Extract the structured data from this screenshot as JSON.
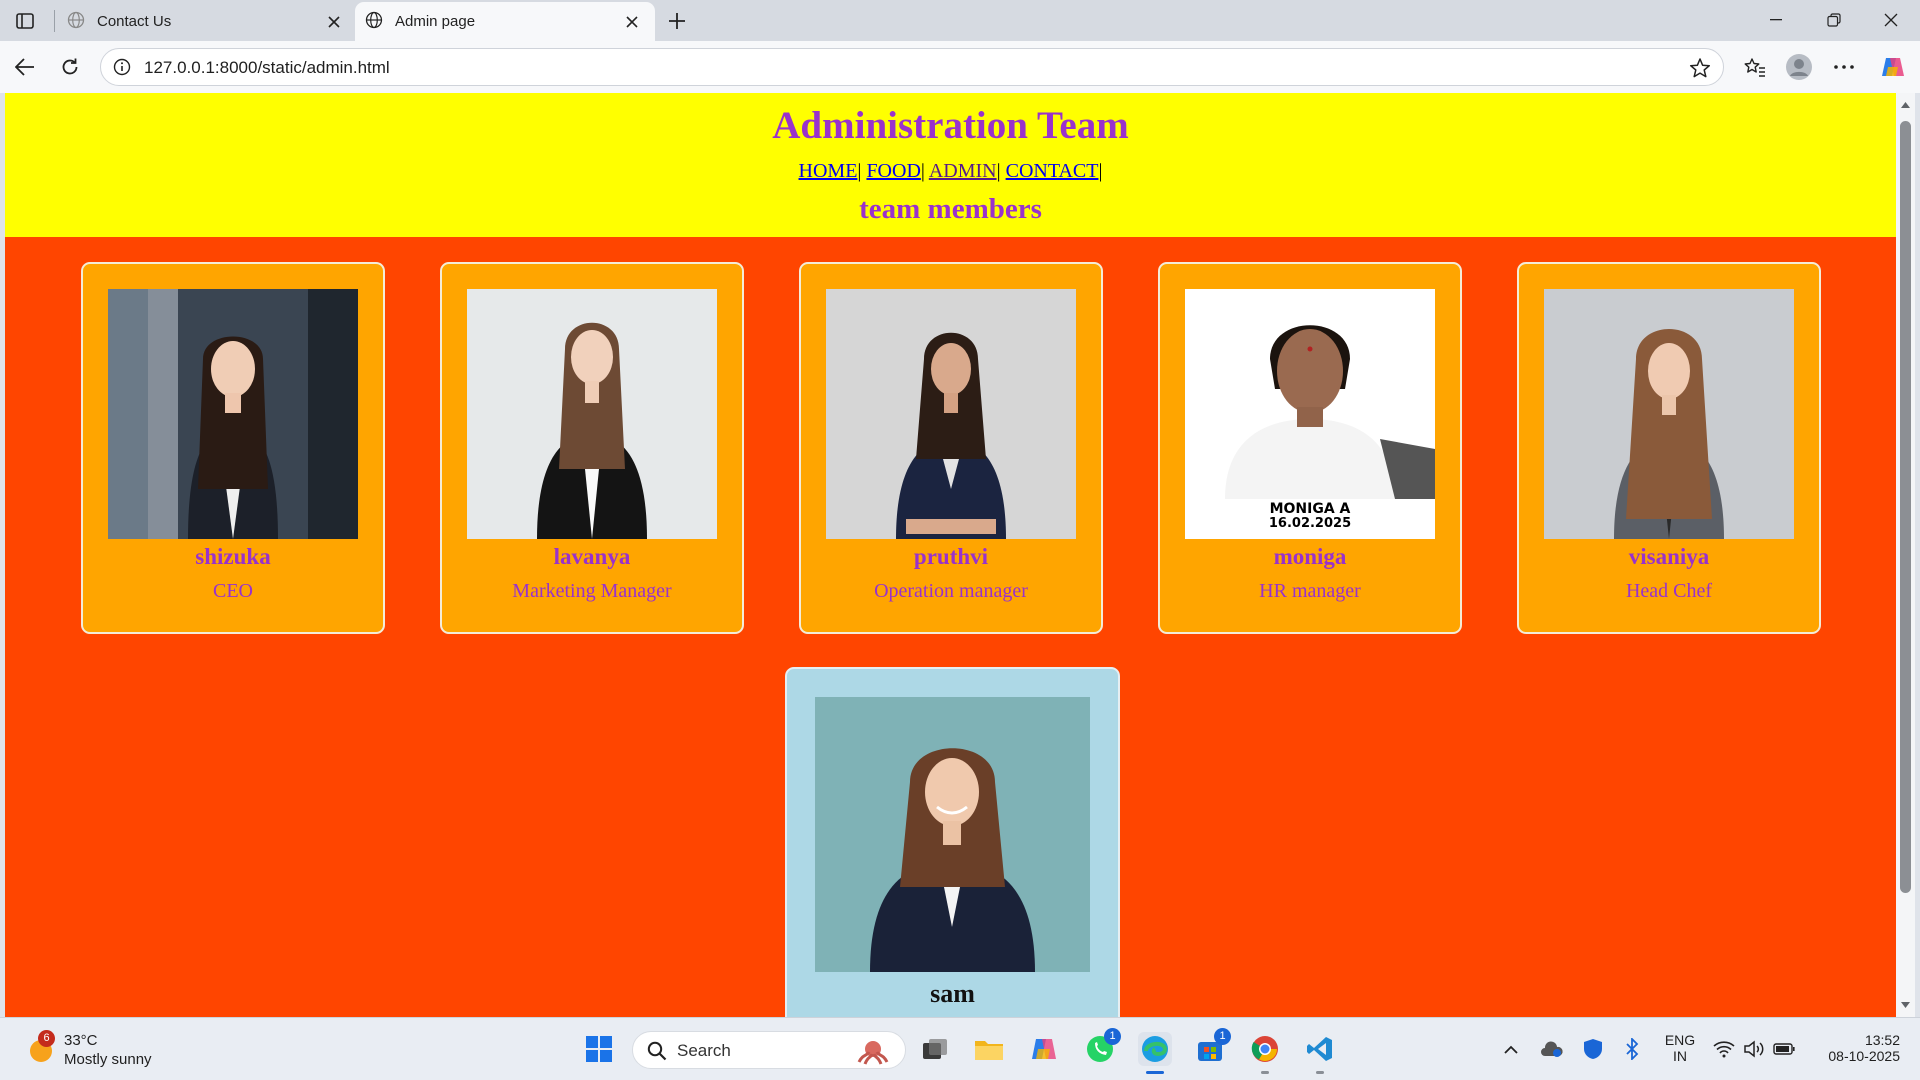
{
  "browser": {
    "tabs": [
      {
        "title": "Contact Us",
        "active": false
      },
      {
        "title": "Admin page",
        "active": true
      }
    ],
    "url": "127.0.0.1:8000/static/admin.html"
  },
  "page": {
    "title": "Administration Team",
    "nav": [
      {
        "label": "HOME"
      },
      {
        "label": "FOOD"
      },
      {
        "label": "ADMIN"
      },
      {
        "label": "CONTACT"
      }
    ],
    "subtitle": "team members",
    "members": [
      {
        "name": "shizuka",
        "role": "CEO"
      },
      {
        "name": "lavanya",
        "role": "Marketing Manager"
      },
      {
        "name": "pruthvi",
        "role": "Operation manager"
      },
      {
        "name": "moniga",
        "role": "HR manager",
        "photo_caption": "MONIGA A",
        "photo_date": "16.02.2025"
      },
      {
        "name": "visaniya",
        "role": "Head Chef"
      },
      {
        "name": "sam",
        "role": ""
      }
    ],
    "colors": {
      "header_bg": "#ffff00",
      "page_bg": "#ff4500",
      "card_bg": "#ffa500",
      "highlight_card_bg": "#add8e6",
      "accent_text": "#9932cc"
    }
  },
  "taskbar": {
    "weather_badge": "6",
    "temperature": "33°C",
    "condition": "Mostly sunny",
    "search_label": "Search",
    "whatsapp_badge": "1",
    "store_badge": "1",
    "language": "ENG",
    "region": "IN",
    "time": "13:52",
    "date": "08-10-2025"
  }
}
